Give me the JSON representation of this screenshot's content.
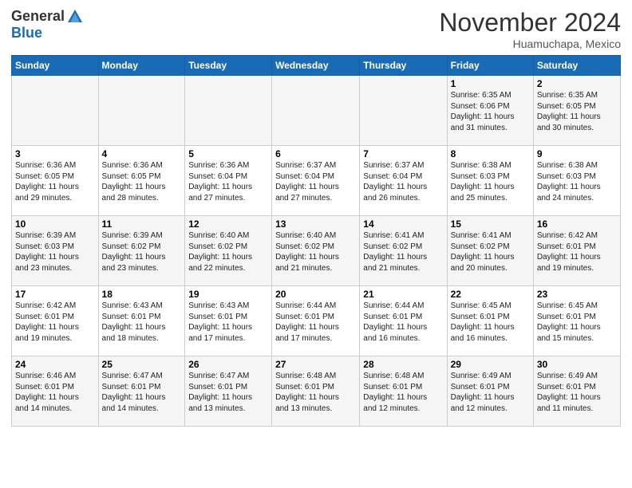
{
  "header": {
    "logo_general": "General",
    "logo_blue": "Blue",
    "month_title": "November 2024",
    "location": "Huamuchapa, Mexico"
  },
  "days_of_week": [
    "Sunday",
    "Monday",
    "Tuesday",
    "Wednesday",
    "Thursday",
    "Friday",
    "Saturday"
  ],
  "weeks": [
    [
      {
        "day": "",
        "info": ""
      },
      {
        "day": "",
        "info": ""
      },
      {
        "day": "",
        "info": ""
      },
      {
        "day": "",
        "info": ""
      },
      {
        "day": "",
        "info": ""
      },
      {
        "day": "1",
        "info": "Sunrise: 6:35 AM\nSunset: 6:06 PM\nDaylight: 11 hours\nand 31 minutes."
      },
      {
        "day": "2",
        "info": "Sunrise: 6:35 AM\nSunset: 6:05 PM\nDaylight: 11 hours\nand 30 minutes."
      }
    ],
    [
      {
        "day": "3",
        "info": "Sunrise: 6:36 AM\nSunset: 6:05 PM\nDaylight: 11 hours\nand 29 minutes."
      },
      {
        "day": "4",
        "info": "Sunrise: 6:36 AM\nSunset: 6:05 PM\nDaylight: 11 hours\nand 28 minutes."
      },
      {
        "day": "5",
        "info": "Sunrise: 6:36 AM\nSunset: 6:04 PM\nDaylight: 11 hours\nand 27 minutes."
      },
      {
        "day": "6",
        "info": "Sunrise: 6:37 AM\nSunset: 6:04 PM\nDaylight: 11 hours\nand 27 minutes."
      },
      {
        "day": "7",
        "info": "Sunrise: 6:37 AM\nSunset: 6:04 PM\nDaylight: 11 hours\nand 26 minutes."
      },
      {
        "day": "8",
        "info": "Sunrise: 6:38 AM\nSunset: 6:03 PM\nDaylight: 11 hours\nand 25 minutes."
      },
      {
        "day": "9",
        "info": "Sunrise: 6:38 AM\nSunset: 6:03 PM\nDaylight: 11 hours\nand 24 minutes."
      }
    ],
    [
      {
        "day": "10",
        "info": "Sunrise: 6:39 AM\nSunset: 6:03 PM\nDaylight: 11 hours\nand 23 minutes."
      },
      {
        "day": "11",
        "info": "Sunrise: 6:39 AM\nSunset: 6:02 PM\nDaylight: 11 hours\nand 23 minutes."
      },
      {
        "day": "12",
        "info": "Sunrise: 6:40 AM\nSunset: 6:02 PM\nDaylight: 11 hours\nand 22 minutes."
      },
      {
        "day": "13",
        "info": "Sunrise: 6:40 AM\nSunset: 6:02 PM\nDaylight: 11 hours\nand 21 minutes."
      },
      {
        "day": "14",
        "info": "Sunrise: 6:41 AM\nSunset: 6:02 PM\nDaylight: 11 hours\nand 21 minutes."
      },
      {
        "day": "15",
        "info": "Sunrise: 6:41 AM\nSunset: 6:02 PM\nDaylight: 11 hours\nand 20 minutes."
      },
      {
        "day": "16",
        "info": "Sunrise: 6:42 AM\nSunset: 6:01 PM\nDaylight: 11 hours\nand 19 minutes."
      }
    ],
    [
      {
        "day": "17",
        "info": "Sunrise: 6:42 AM\nSunset: 6:01 PM\nDaylight: 11 hours\nand 19 minutes."
      },
      {
        "day": "18",
        "info": "Sunrise: 6:43 AM\nSunset: 6:01 PM\nDaylight: 11 hours\nand 18 minutes."
      },
      {
        "day": "19",
        "info": "Sunrise: 6:43 AM\nSunset: 6:01 PM\nDaylight: 11 hours\nand 17 minutes."
      },
      {
        "day": "20",
        "info": "Sunrise: 6:44 AM\nSunset: 6:01 PM\nDaylight: 11 hours\nand 17 minutes."
      },
      {
        "day": "21",
        "info": "Sunrise: 6:44 AM\nSunset: 6:01 PM\nDaylight: 11 hours\nand 16 minutes."
      },
      {
        "day": "22",
        "info": "Sunrise: 6:45 AM\nSunset: 6:01 PM\nDaylight: 11 hours\nand 16 minutes."
      },
      {
        "day": "23",
        "info": "Sunrise: 6:45 AM\nSunset: 6:01 PM\nDaylight: 11 hours\nand 15 minutes."
      }
    ],
    [
      {
        "day": "24",
        "info": "Sunrise: 6:46 AM\nSunset: 6:01 PM\nDaylight: 11 hours\nand 14 minutes."
      },
      {
        "day": "25",
        "info": "Sunrise: 6:47 AM\nSunset: 6:01 PM\nDaylight: 11 hours\nand 14 minutes."
      },
      {
        "day": "26",
        "info": "Sunrise: 6:47 AM\nSunset: 6:01 PM\nDaylight: 11 hours\nand 13 minutes."
      },
      {
        "day": "27",
        "info": "Sunrise: 6:48 AM\nSunset: 6:01 PM\nDaylight: 11 hours\nand 13 minutes."
      },
      {
        "day": "28",
        "info": "Sunrise: 6:48 AM\nSunset: 6:01 PM\nDaylight: 11 hours\nand 12 minutes."
      },
      {
        "day": "29",
        "info": "Sunrise: 6:49 AM\nSunset: 6:01 PM\nDaylight: 11 hours\nand 12 minutes."
      },
      {
        "day": "30",
        "info": "Sunrise: 6:49 AM\nSunset: 6:01 PM\nDaylight: 11 hours\nand 11 minutes."
      }
    ]
  ]
}
